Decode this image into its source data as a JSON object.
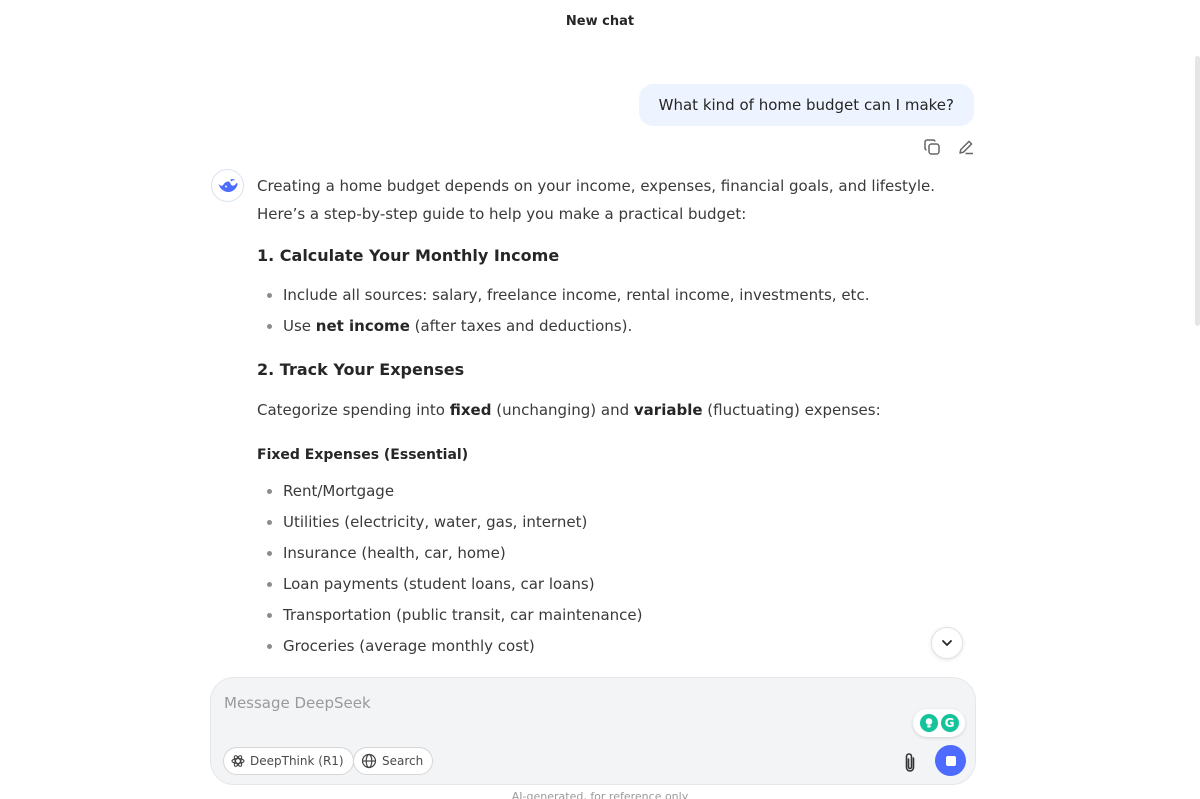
{
  "header": {
    "title": "New chat"
  },
  "user_message": {
    "text": "What kind of home budget can I make?"
  },
  "user_actions": {
    "copy_icon": "copy-icon",
    "edit_icon": "pencil-icon"
  },
  "assistant": {
    "avatar_icon": "deepseek-whale-icon",
    "intro": "Creating a home budget depends on your income, expenses, financial goals, and lifestyle. Here’s a step-by-step guide to help you make a practical budget:",
    "section1": {
      "heading": "1. Calculate Your Monthly Income",
      "bullet1": "Include all sources: salary, freelance income, rental income, investments, etc.",
      "bullet2": {
        "pre": "Use ",
        "bold": "net income",
        "post": " (after taxes and deductions)."
      }
    },
    "section2": {
      "heading": "2. Track Your Expenses",
      "para": {
        "pre": "Categorize spending into ",
        "bold1": "fixed",
        "mid": " (unchanging) and ",
        "bold2": "variable",
        "post": " (fluctuating) expenses:"
      },
      "fixed_heading": "Fixed Expenses (Essential)",
      "fixed_items": [
        "Rent/Mortgage",
        "Utilities (electricity, water, gas, internet)",
        "Insurance (health, car, home)",
        "Loan payments (student loans, car loans)",
        "Transportation (public transit, car maintenance)",
        "Groceries (average monthly cost)"
      ]
    }
  },
  "composer": {
    "placeholder": "Message DeepSeek",
    "deepthink_label": "DeepThink (R1)",
    "search_label": "Search"
  },
  "footer": {
    "note": "AI-generated, for reference only"
  },
  "colors": {
    "accent": "#4d6bfe",
    "bubble": "#eef4ff",
    "grammarly": "#15c39a"
  }
}
